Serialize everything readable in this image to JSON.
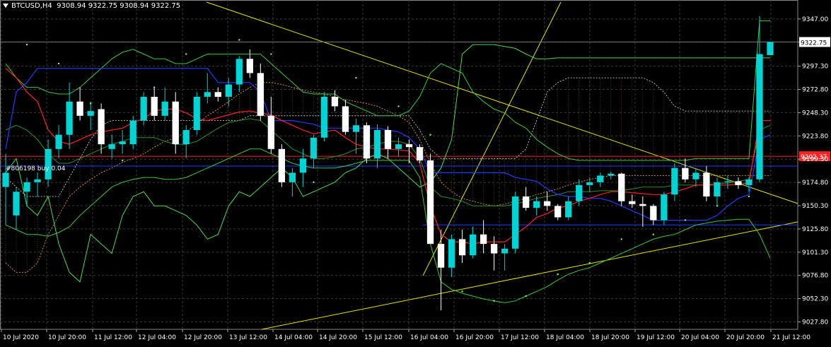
{
  "header": {
    "symbol": "BTCUSD,H4",
    "ohlc": "9308.94 9322.75 9308.94 9322.75"
  },
  "order_label": "#806198 buy 0.04",
  "colors": {
    "bull": "#00d3d3",
    "bear": "#ffffff",
    "grid": "#3a3a3a",
    "trend": "#e6e600",
    "ma_red": "#ff2020",
    "ma_blue": "#1f3cff",
    "green": "#3cc83c",
    "ichimoku": "#d28a3c",
    "ask": "#ff2020",
    "bid": "#1f3cff",
    "price_tag": "#ffffff",
    "axis_text": "#ffffff"
  },
  "chart_data": {
    "type": "candlestick",
    "symbol": "BTCUSD",
    "timeframe": "H4",
    "ylim": [
      9020,
      9367
    ],
    "yticks": [
      9347.0,
      9322.75,
      9297.3,
      9272.8,
      9248.3,
      9223.8,
      9199.3,
      9174.8,
      9150.3,
      9125.8,
      9101.3,
      9076.8,
      9052.3,
      9027.8
    ],
    "xticks": [
      "10 Jul 2020",
      "10 Jul 20:00",
      "11 Jul 12:00",
      "12 Jul 04:00",
      "12 Jul 20:00",
      "13 Jul 12:00",
      "14 Jul 04:00",
      "14 Jul 20:00",
      "15 Jul 12:00",
      "16 Jul 04:00",
      "16 Jul 20:00",
      "17 Jul 12:00",
      "18 Jul 04:00",
      "18 Jul 20:00",
      "19 Jul 12:00",
      "20 Jul 04:00",
      "20 Jul 20:00",
      "21 Jul 12:00"
    ],
    "last_price": "9322.75",
    "ask_price": "9202.37",
    "candles": [
      [
        9170,
        9205,
        9130,
        9185
      ],
      [
        9140,
        9170,
        9125,
        9165
      ],
      [
        9165,
        9180,
        9150,
        9175
      ],
      [
        9175,
        9185,
        9160,
        9178
      ],
      [
        9178,
        9220,
        9170,
        9210
      ],
      [
        9210,
        9235,
        9200,
        9225
      ],
      [
        9225,
        9280,
        9210,
        9260
      ],
      [
        9260,
        9275,
        9240,
        9245
      ],
      [
        9245,
        9260,
        9230,
        9250
      ],
      [
        9252,
        9258,
        9205,
        9215
      ],
      [
        9210,
        9225,
        9200,
        9215
      ],
      [
        9215,
        9230,
        9205,
        9218
      ],
      [
        9215,
        9245,
        9210,
        9240
      ],
      [
        9240,
        9270,
        9235,
        9265
      ],
      [
        9265,
        9275,
        9240,
        9245
      ],
      [
        9245,
        9275,
        9240,
        9260
      ],
      [
        9260,
        9270,
        9205,
        9215
      ],
      [
        9215,
        9235,
        9200,
        9230
      ],
      [
        9230,
        9270,
        9225,
        9265
      ],
      [
        9265,
        9290,
        9258,
        9270
      ],
      [
        9270,
        9275,
        9260,
        9265
      ],
      [
        9265,
        9285,
        9255,
        9278
      ],
      [
        9278,
        9308,
        9270,
        9305
      ],
      [
        9305,
        9315,
        9285,
        9290
      ],
      [
        9290,
        9300,
        9240,
        9245
      ],
      [
        9245,
        9265,
        9205,
        9210
      ],
      [
        9210,
        9215,
        9170,
        9175
      ],
      [
        9175,
        9190,
        9160,
        9185
      ],
      [
        9185,
        9210,
        9170,
        9200
      ],
      [
        9200,
        9225,
        9190,
        9222
      ],
      [
        9222,
        9270,
        9218,
        9265
      ],
      [
        9265,
        9272,
        9250,
        9255
      ],
      [
        9255,
        9262,
        9225,
        9228
      ],
      [
        9228,
        9242,
        9205,
        9235
      ],
      [
        9235,
        9238,
        9195,
        9200
      ],
      [
        9200,
        9236,
        9190,
        9230
      ],
      [
        9230,
        9234,
        9200,
        9210
      ],
      [
        9210,
        9222,
        9202,
        9215
      ],
      [
        9215,
        9220,
        9195,
        9212
      ],
      [
        9212,
        9215,
        9195,
        9198
      ],
      [
        9198,
        9205,
        9115,
        9110
      ],
      [
        9110,
        9125,
        9040,
        9085
      ],
      [
        9085,
        9120,
        9075,
        9115
      ],
      [
        9115,
        9125,
        9090,
        9098
      ],
      [
        9098,
        9128,
        9095,
        9120
      ],
      [
        9120,
        9135,
        9100,
        9110
      ],
      [
        9110,
        9118,
        9082,
        9100
      ],
      [
        9100,
        9110,
        9082,
        9105
      ],
      [
        9105,
        9165,
        9100,
        9160
      ],
      [
        9160,
        9170,
        9145,
        9148
      ],
      [
        9148,
        9160,
        9140,
        9155
      ],
      [
        9155,
        9165,
        9145,
        9150
      ],
      [
        9150,
        9152,
        9135,
        9138
      ],
      [
        9138,
        9160,
        9135,
        9155
      ],
      [
        9155,
        9178,
        9150,
        9172
      ],
      [
        9172,
        9180,
        9165,
        9175
      ],
      [
        9175,
        9185,
        9170,
        9182
      ],
      [
        9182,
        9186,
        9178,
        9184
      ],
      [
        9184,
        9185,
        9150,
        9155
      ],
      [
        9155,
        9162,
        9148,
        9152
      ],
      [
        9152,
        9160,
        9128,
        9150
      ],
      [
        9150,
        9152,
        9130,
        9135
      ],
      [
        9135,
        9165,
        9130,
        9162
      ],
      [
        9162,
        9195,
        9155,
        9190
      ],
      [
        9190,
        9200,
        9175,
        9178
      ],
      [
        9178,
        9190,
        9170,
        9185
      ],
      [
        9185,
        9192,
        9155,
        9160
      ],
      [
        9160,
        9180,
        9150,
        9175
      ],
      [
        9175,
        9182,
        9168,
        9176
      ],
      [
        9176,
        9180,
        9168,
        9172
      ],
      [
        9172,
        9180,
        9165,
        9178
      ],
      [
        9178,
        9350,
        9175,
        9310
      ],
      [
        9308.94,
        9322.75,
        9308.94,
        9322.75
      ]
    ],
    "ma_red": [
      9295,
      9285,
      9270,
      9260,
      9230,
      9218,
      9215,
      9220,
      9225,
      9228,
      9230,
      9232,
      9238,
      9242,
      9250,
      9252,
      9252,
      9248,
      9242,
      9240,
      9243,
      9246,
      9249,
      9250,
      9248,
      9246,
      9240,
      9235,
      9230,
      9226,
      9228,
      9230,
      9222,
      9215,
      9212,
      9210,
      9210,
      9209,
      9208,
      9195,
      9150,
      9120,
      9112,
      9112,
      9110,
      9112,
      9112,
      9112,
      9120,
      9128,
      9138,
      9142,
      9148,
      9150,
      9155,
      9158,
      9162,
      9165,
      9165,
      9164,
      9163,
      9162,
      9162,
      9165,
      9168,
      9172,
      9172,
      9172,
      9172,
      9173,
      9174,
      9240,
      9240
    ],
    "ma_blue": [
      9210,
      9270,
      9280,
      9295,
      9295,
      9295,
      9295,
      9295,
      9295,
      9295,
      9295,
      9295,
      9295,
      9295,
      9295,
      9295,
      9295,
      9295,
      9295,
      9295,
      9280,
      9280,
      9280,
      9280,
      9270,
      9240,
      9240,
      9240,
      9238,
      9236,
      9232,
      9232,
      9232,
      9232,
      9232,
      9232,
      9230,
      9228,
      9222,
      9210,
      9185,
      9185,
      9185,
      9185,
      9185,
      9185,
      9185,
      9185,
      9180,
      9178,
      9176,
      9168,
      9162,
      9160,
      9160,
      9158,
      9158,
      9155,
      9150,
      9145,
      9140,
      9135,
      9135,
      9135,
      9135,
      9135,
      9135,
      9140,
      9150,
      9158,
      9162,
      9220,
      9225
    ],
    "green_upper": [
      9300,
      9285,
      9275,
      9275,
      9270,
      9268,
      9268,
      9275,
      9285,
      9295,
      9305,
      9312,
      9315,
      9310,
      9305,
      9305,
      9300,
      9300,
      9305,
      9310,
      9310,
      9310,
      9310,
      9310,
      9310,
      9300,
      9290,
      9280,
      9270,
      9268,
      9268,
      9268,
      9260,
      9255,
      9250,
      9245,
      9245,
      9245,
      9250,
      9265,
      9290,
      9300,
      9295,
      9290,
      9270,
      9260,
      9252,
      9248,
      9238,
      9232,
      9220,
      9212,
      9205,
      9200,
      9198,
      9198,
      9198,
      9198,
      9198,
      9198,
      9198,
      9198,
      9198,
      9198,
      9198,
      9200,
      9200,
      9200,
      9200,
      9200,
      9200,
      9345,
      9345
    ],
    "green_lower": [
      9130,
      9125,
      9120,
      9120,
      9118,
      9122,
      9128,
      9140,
      9150,
      9160,
      9170,
      9175,
      9178,
      9180,
      9180,
      9178,
      9178,
      9180,
      9185,
      9190,
      9195,
      9200,
      9205,
      9210,
      9210,
      9205,
      9200,
      9195,
      9192,
      9190,
      9190,
      9190,
      9192,
      9195,
      9198,
      9198,
      9198,
      9198,
      9198,
      9180,
      9110,
      9070,
      9062,
      9058,
      9055,
      9052,
      9050,
      9048,
      9050,
      9055,
      9060,
      9065,
      9072,
      9078,
      9082,
      9085,
      9090,
      9095,
      9100,
      9105,
      9110,
      9115,
      9118,
      9120,
      9125,
      9130,
      9132,
      9134,
      9135,
      9136,
      9136,
      9120,
      9095
    ],
    "green_mid": [
      9230,
      9235,
      9230,
      9220,
      9205,
      9195,
      9195,
      9200,
      9205,
      9210,
      9215,
      9218,
      9222,
      9222,
      9222,
      9218,
      9215,
      9215,
      9218,
      9225,
      9232,
      9238,
      9240,
      9242,
      9240,
      9230,
      9220,
      9210,
      9205,
      9200,
      9200,
      9202,
      9205,
      9210,
      9212,
      9215,
      9218,
      9218,
      9215,
      9200,
      9170,
      9160,
      9158,
      9155,
      9150,
      9150,
      9150,
      9150,
      9152,
      9155,
      9158,
      9160,
      9162,
      9165,
      9165,
      9165,
      9166,
      9166,
      9166,
      9168,
      9170,
      9170,
      9170,
      9172,
      9172,
      9172,
      9172,
      9174,
      9174,
      9176,
      9178,
      9230,
      9235
    ],
    "lagging_green": [
      9185,
      9200,
      9150,
      9140,
      9160,
      9110,
      9080,
      9070,
      9120,
      9110,
      9100,
      9140,
      9160,
      9165,
      9150,
      9150,
      9145,
      9140,
      9130,
      9115,
      9120,
      9150,
      9165,
      9160,
      9170,
      9180,
      9190,
      9180,
      9160,
      9165,
      9170,
      9175,
      9185,
      9190,
      9200,
      9205,
      9200,
      9190,
      9180,
      9170,
      9175,
      9190,
      9220,
      9310,
      9320,
      9320,
      9320,
      9318,
      9316,
      9310,
      9305,
      9305,
      9306,
      9306,
      9306,
      9306,
      9306,
      9306,
      9306,
      9306,
      9306,
      9306,
      9306,
      9306,
      9306,
      9306,
      9306,
      9306,
      9306,
      9306,
      9306,
      9306,
      9306
    ],
    "ichimoku_a": [
      9090,
      9080,
      9080,
      9090,
      9120,
      9140,
      9160,
      9170,
      9178,
      9185,
      9190,
      9196,
      9200,
      9205,
      9212,
      9218,
      9222,
      9228,
      9236,
      9245,
      9252,
      9260,
      9268,
      9275,
      9280,
      9280,
      9278,
      9275,
      9272,
      9270,
      9268,
      9265,
      9262,
      9260,
      9258,
      9255,
      9250,
      9245,
      9238,
      9220,
      9195,
      9175,
      9165,
      9158,
      9155,
      9152,
      9150,
      9152,
      9155,
      9158,
      9162,
      9165,
      9168,
      9172,
      9175,
      9178,
      9180,
      9182,
      9182,
      9182,
      9182,
      9182,
      9182,
      9182,
      9182,
      9182,
      9182,
      9182,
      9182,
      9182,
      9182,
      9182,
      9182
    ],
    "ichimoku_b": [
      9180,
      9170,
      9160,
      9160,
      9160,
      9160,
      9180,
      9200,
      9220,
      9235,
      9240,
      9240,
      9240,
      9240,
      9240,
      9240,
      9240,
      9240,
      9240,
      9240,
      9240,
      9240,
      9240,
      9245,
      9245,
      9245,
      9245,
      9245,
      9245,
      9245,
      9245,
      9245,
      9245,
      9245,
      9245,
      9245,
      9245,
      9245,
      9245,
      9230,
      9210,
      9200,
      9200,
      9200,
      9200,
      9200,
      9200,
      9200,
      9200,
      9210,
      9240,
      9270,
      9280,
      9285,
      9285,
      9285,
      9285,
      9285,
      9285,
      9285,
      9285,
      9280,
      9270,
      9255,
      9250,
      9250,
      9250,
      9250,
      9250,
      9250,
      9250,
      9250,
      9250
    ],
    "sar_points": [
      [
        2,
        9320
      ],
      [
        5,
        9300
      ],
      [
        8,
        9258
      ],
      [
        11,
        9198
      ],
      [
        14,
        9275
      ],
      [
        17,
        9310
      ],
      [
        22,
        9325
      ],
      [
        25,
        9310
      ],
      [
        29,
        9175
      ],
      [
        33,
        9285
      ],
      [
        37,
        9255
      ],
      [
        40,
        9225
      ],
      [
        43,
        9060
      ],
      [
        46,
        9050
      ],
      [
        49,
        9055
      ],
      [
        52,
        9078
      ],
      [
        55,
        9090
      ],
      [
        58,
        9115
      ],
      [
        61,
        9120
      ],
      [
        64,
        9135
      ],
      [
        67,
        9150
      ],
      [
        70,
        9160
      ]
    ]
  }
}
